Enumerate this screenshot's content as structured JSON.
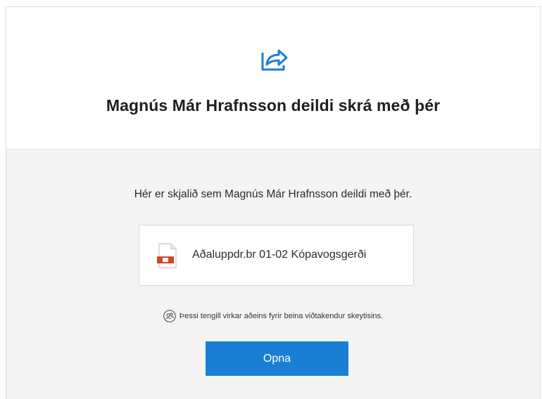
{
  "header": {
    "icon": "share-arrow-icon",
    "title": "Magnús Már Hrafnsson deildi skrá með þér"
  },
  "main": {
    "intro": "Hér er skjalið sem Magnús Már Hrafnsson deildi með þér.",
    "file": {
      "icon": "pdf-file-icon",
      "name": "Aðaluppdr.br 01-02 Kópavogsgerði"
    },
    "note": {
      "icon": "people-icon",
      "text": "Þessi tengill virkar aðeins fyrir beina viðtakendur skeytisins."
    },
    "open_label": "Opna"
  },
  "colors": {
    "accent": "#1a7fd4",
    "pdf": "#d24726"
  }
}
